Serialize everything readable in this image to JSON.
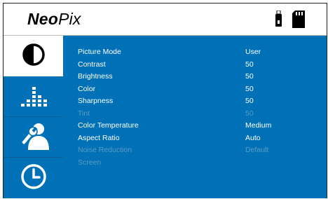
{
  "brand": {
    "bold": "Neo",
    "regular": "Pix"
  },
  "header_icons": [
    "usb-drive-icon",
    "sd-card-icon"
  ],
  "sidebar": {
    "items": [
      {
        "name": "picture",
        "icon": "contrast-circle-icon",
        "active": true
      },
      {
        "name": "audio",
        "icon": "equalizer-icon",
        "active": false
      },
      {
        "name": "settings",
        "icon": "user-wrench-icon",
        "active": false
      },
      {
        "name": "time",
        "icon": "clock-icon",
        "active": false
      }
    ]
  },
  "menu": {
    "rows": [
      {
        "label": "Picture Mode",
        "value": "User",
        "enabled": true
      },
      {
        "label": "Contrast",
        "value": "50",
        "enabled": true
      },
      {
        "label": "Brightness",
        "value": "50",
        "enabled": true
      },
      {
        "label": "Color",
        "value": "50",
        "enabled": true
      },
      {
        "label": "Sharpness",
        "value": "50",
        "enabled": true
      },
      {
        "label": "Tint",
        "value": "50",
        "enabled": false
      },
      {
        "label": "Color Temperature",
        "value": "Medium",
        "enabled": true
      },
      {
        "label": "Aspect Ratio",
        "value": "Auto",
        "enabled": true
      },
      {
        "label": "Noise Reduction",
        "value": "Default",
        "enabled": false
      },
      {
        "label": "Screen",
        "value": "",
        "enabled": false
      }
    ]
  },
  "colors": {
    "panel_blue": "#0071b6",
    "text_white": "#ffffff",
    "text_disabled": "#5c9cc6"
  }
}
